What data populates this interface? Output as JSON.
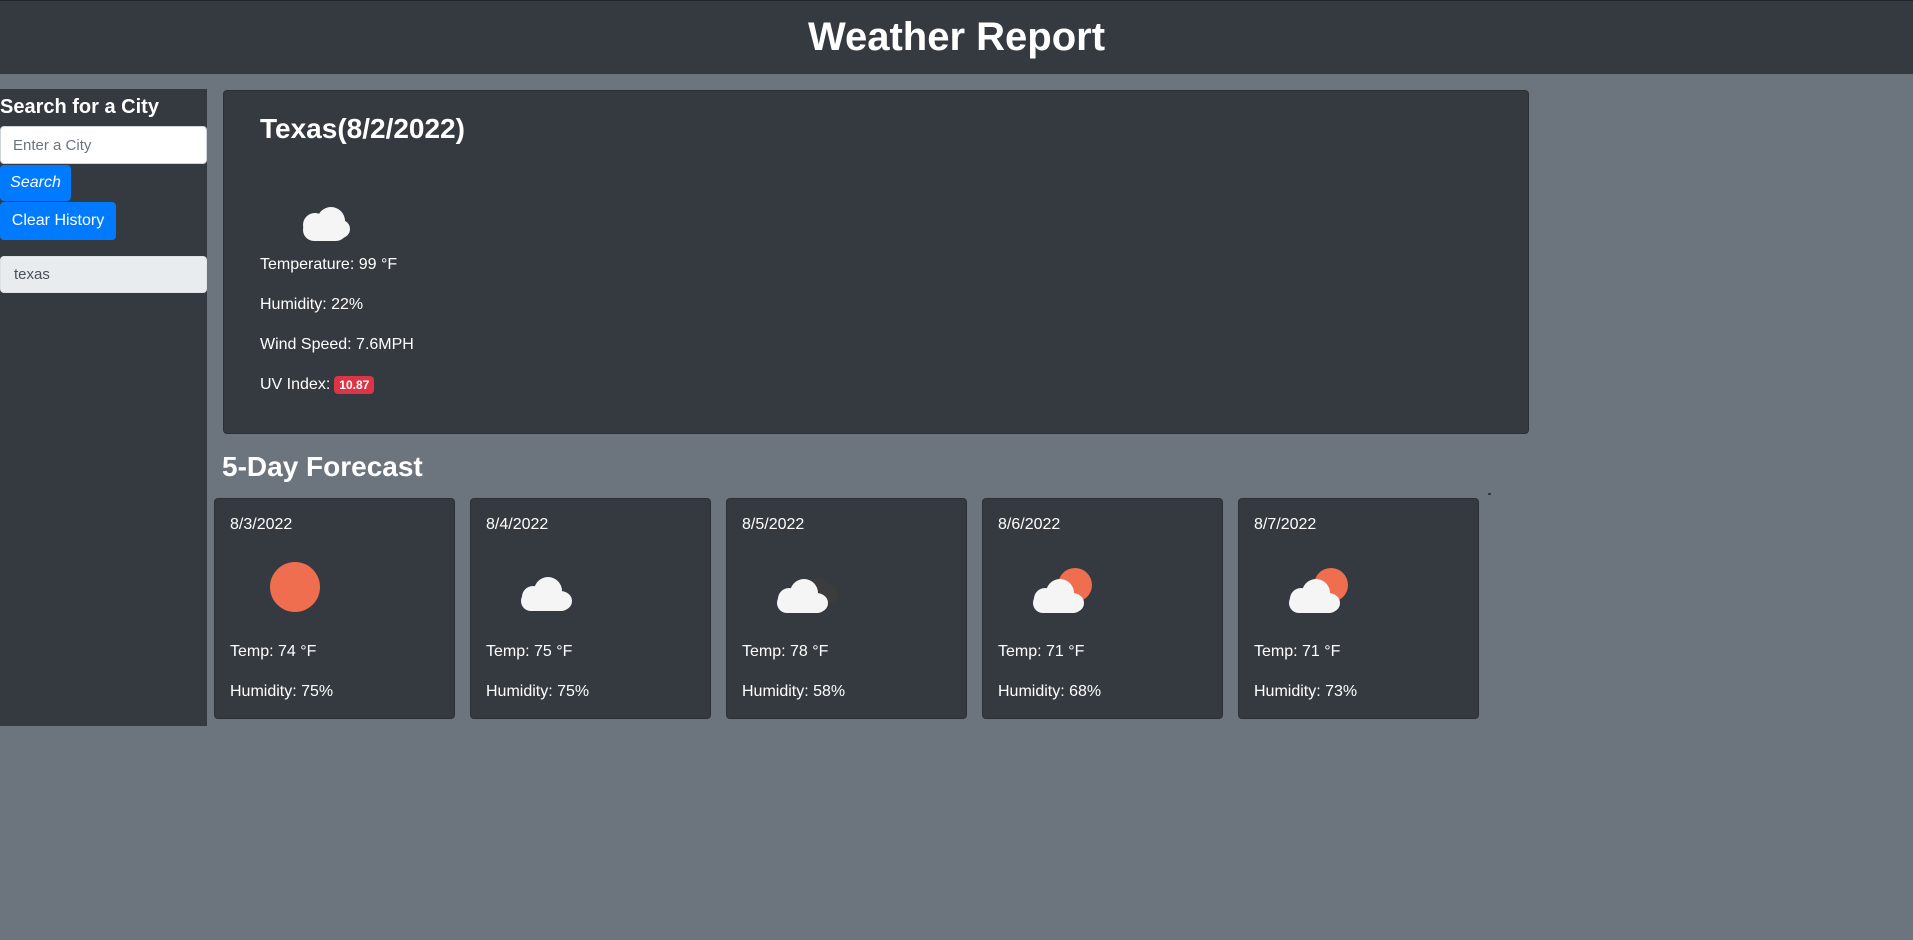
{
  "app": {
    "title": "Weather Report"
  },
  "sidebar": {
    "heading": "Search for a City",
    "search_placeholder": "Enter a City",
    "search_value": "",
    "search_label": "Search",
    "clear_label": "Clear History",
    "history": [
      "texas"
    ]
  },
  "current": {
    "title": "Texas(8/2/2022)",
    "icon": "cloud-icon",
    "temperature": "Temperature: 99 °F",
    "humidity": "Humidity: 22%",
    "wind": "Wind Speed: 7.6MPH",
    "uv_label": "UV Index:",
    "uv_value": "10.87"
  },
  "forecast": {
    "title": "5-Day Forecast",
    "days": [
      {
        "date": "8/3/2022",
        "icon": "sun-icon",
        "temp": "Temp: 74 °F",
        "humidity": "Humidity: 75%"
      },
      {
        "date": "8/4/2022",
        "icon": "cloud-icon",
        "temp": "Temp: 75 °F",
        "humidity": "Humidity: 75%"
      },
      {
        "date": "8/5/2022",
        "icon": "clouds-icon",
        "temp": "Temp: 78 °F",
        "humidity": "Humidity: 58%"
      },
      {
        "date": "8/6/2022",
        "icon": "partly-cloudy-icon",
        "temp": "Temp: 71 °F",
        "humidity": "Humidity: 68%"
      },
      {
        "date": "8/7/2022",
        "icon": "partly-cloudy-icon",
        "temp": "Temp: 71 °F",
        "humidity": "Humidity: 73%"
      }
    ]
  },
  "colors": {
    "page_bg": "#6c757d",
    "panel_bg": "#343a40",
    "primary": "#007bff",
    "danger": "#dc3545",
    "sun": "#ee6e4f",
    "cloud": "#f5f5f5",
    "dark_cloud": "#3c3c3c"
  }
}
